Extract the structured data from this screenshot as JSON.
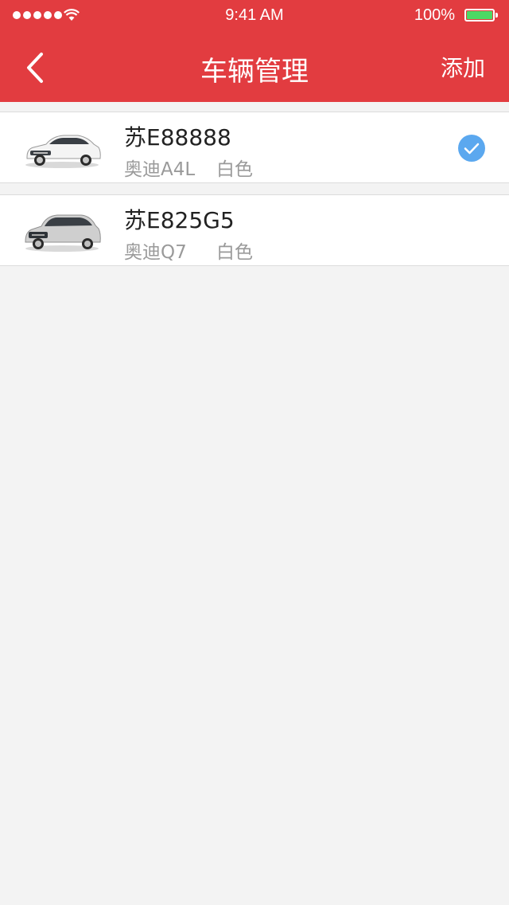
{
  "status_bar": {
    "time": "9:41 AM",
    "battery_pct": "100%",
    "signal_icon": "signal-dots-icon",
    "wifi_icon": "wifi-icon",
    "battery_icon": "battery-icon",
    "battery_level": 1.0
  },
  "nav": {
    "back_icon": "chevron-left-icon",
    "title": "车辆管理",
    "action_label": "添加"
  },
  "colors": {
    "brand": "#e23c40",
    "check": "#5ba8ef",
    "battery": "#4cd964"
  },
  "vehicles": [
    {
      "plate": "苏E88888",
      "model": "奥迪A4L",
      "color": "白色",
      "selected": true
    },
    {
      "plate": "苏E825G5",
      "model": "奥迪Q7",
      "color": "白色",
      "selected": false
    }
  ]
}
